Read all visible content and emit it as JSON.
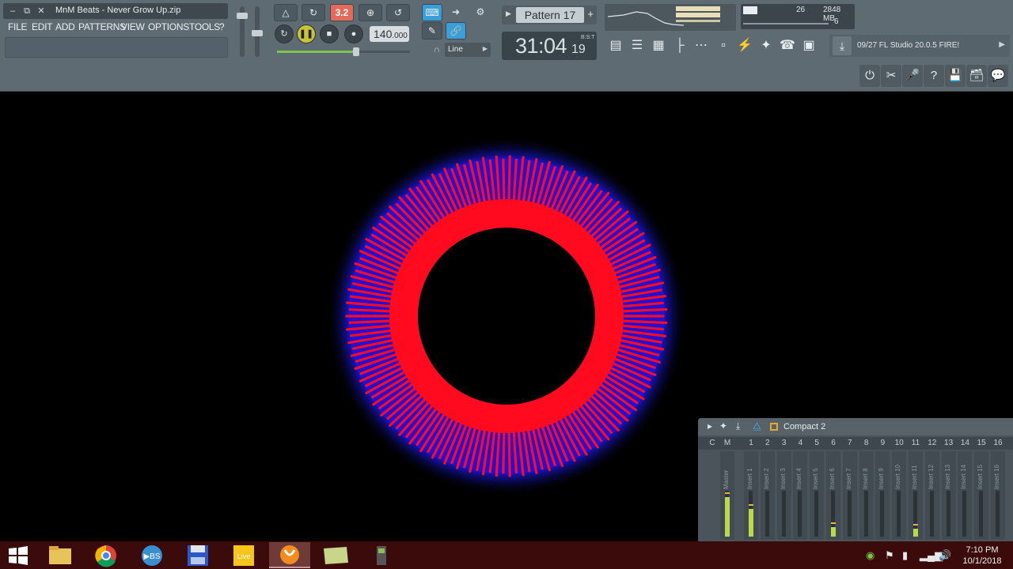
{
  "window": {
    "title": "MnM Beats - Never Grow Up.zip",
    "minimize_icon": "minimize-icon",
    "restore_icon": "restore-icon",
    "close_icon": "close-icon"
  },
  "menu": {
    "items": [
      "FILE",
      "EDIT",
      "ADD",
      "PATTERNS",
      "VIEW",
      "OPTIONS",
      "TOOLS",
      "?"
    ]
  },
  "transport": {
    "tempo_main": "140",
    "tempo_frac": ".000",
    "snap_label": "Line",
    "countdown_label": "3.2"
  },
  "pattern": {
    "name": "Pattern 17",
    "add_label": "+"
  },
  "time": {
    "main": "31:04",
    "ms": "19",
    "unit": "B:S:T"
  },
  "monitor": {
    "cpu_value": "26",
    "memory": "2848 MB",
    "polyphony": "6"
  },
  "news": {
    "text": "09/27  FL Studio 20.0.5 FIRE!",
    "icon": "download-icon"
  },
  "mixer": {
    "preset": "Compact 2",
    "header_labels": [
      "C",
      "M",
      "1",
      "2",
      "3",
      "4",
      "5",
      "6",
      "7",
      "8",
      "9",
      "10",
      "11",
      "12",
      "13",
      "14",
      "15",
      "16"
    ],
    "strips": [
      "Master",
      "Insert 1",
      "Insert 2",
      "Insert 3",
      "Insert 4",
      "Insert 5",
      "Insert 6",
      "Insert 7",
      "Insert 8",
      "Insert 9",
      "Insert 10",
      "Insert 11",
      "Insert 12",
      "Insert 13",
      "Insert 14",
      "Insert 15",
      "Insert 16"
    ],
    "meter_levels": [
      0.5,
      0.35,
      0,
      0,
      0,
      0,
      0.12,
      0,
      0,
      0,
      0,
      0.1,
      0,
      0,
      0,
      0,
      0
    ]
  },
  "visualizer": {
    "ray_count": 150,
    "colors": {
      "outer_glow": "#1e1bff",
      "rays": "#ff0a1e",
      "core": "#000000"
    }
  },
  "taskbar": {
    "apps": [
      "File Explorer",
      "Chrome",
      "BS Player",
      "Save",
      "Live",
      "FL Studio",
      "Notes",
      "Tool"
    ],
    "time": "7:10 PM",
    "date": "10/1/2018"
  },
  "colors": {
    "toolbar": "#5f6b72",
    "accent_red": "#e46a5a",
    "accent_blue": "#3a9ed8",
    "taskbar": "#3b0a0a"
  }
}
